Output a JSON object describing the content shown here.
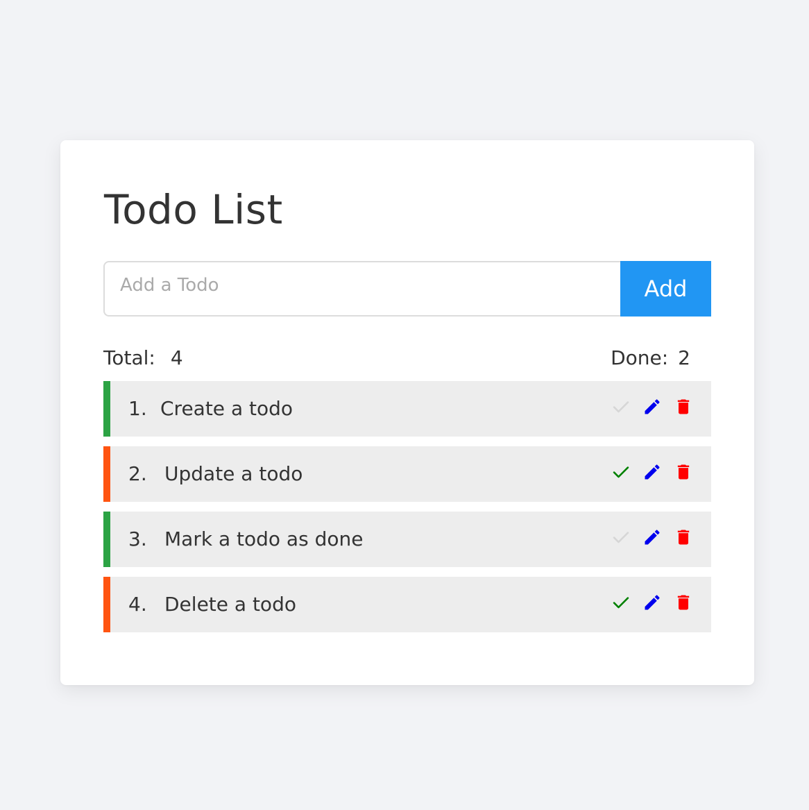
{
  "title": "Todo List",
  "input": {
    "placeholder": "Add a Todo",
    "value": ""
  },
  "add_button_label": "Add",
  "stats": {
    "total_label": "Total:",
    "total_value": "4",
    "done_label": "Done:",
    "done_value": "2"
  },
  "colors": {
    "background": "#f2f3f6",
    "accent": "#2196f3",
    "pending_marker": "#ff5411",
    "done_marker": "#2ca344",
    "check_active": "#008000",
    "check_inactive": "#d6d6d6",
    "edit_icon": "#0000ee",
    "delete_icon": "#ff0000"
  },
  "todos": [
    {
      "index": "1.",
      "text": "Create a todo",
      "status": "done",
      "icons": [
        "check-icon",
        "pencil-icon",
        "trash-icon"
      ]
    },
    {
      "index": "2.",
      "text": "Update a todo",
      "status": "pending",
      "icons": [
        "check-icon",
        "pencil-icon",
        "trash-icon"
      ]
    },
    {
      "index": "3.",
      "text": "Mark a todo as done",
      "status": "done",
      "icons": [
        "check-icon",
        "pencil-icon",
        "trash-icon"
      ]
    },
    {
      "index": "4.",
      "text": "Delete a todo",
      "status": "pending",
      "icons": [
        "check-icon",
        "pencil-icon",
        "trash-icon"
      ]
    }
  ]
}
